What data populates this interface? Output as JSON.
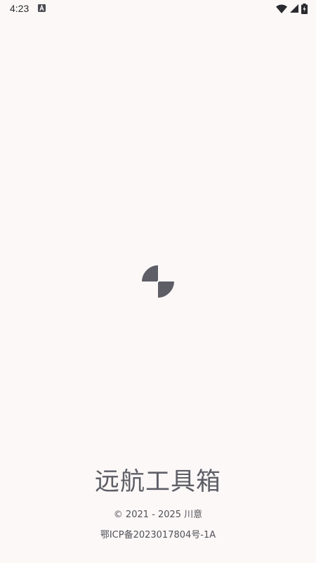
{
  "status_bar": {
    "time": "4:23",
    "notification_icon": "a-notification-icon",
    "wifi_icon": "wifi-icon",
    "signal_icon": "cellular-signal-icon",
    "battery_icon": "battery-charging-icon"
  },
  "splash": {
    "logo_icon": "pinwheel-icon",
    "logo_color": "#5d5e66",
    "app_name": "远航工具箱",
    "copyright": "© 2021 - 2025 川意",
    "icp": "鄂ICP备2023017804号-1A"
  },
  "colors": {
    "background": "#fcf8f7",
    "text": "#5d5e66"
  }
}
